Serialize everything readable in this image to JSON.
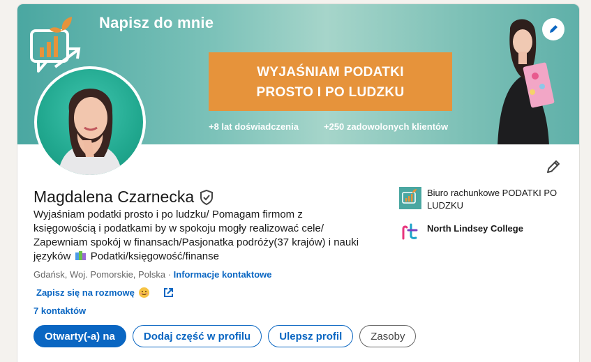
{
  "banner": {
    "heading": "Napisz do mnie",
    "box_line1": "WYJAŚNIAM PODATKI",
    "box_line2": "PROSTO I PO LUDZKU",
    "stat1": "+8 lat doświadczenia",
    "stat2": "+250 zadowolonych klientów"
  },
  "profile": {
    "name": "Magdalena Czarnecka",
    "headline_main": "Wyjaśniam podatki prosto i po ludzku/ Pomagam firmom z księgowością i podatkami by w spokoju mogły realizować cele/ Zapewniam spokój w finansach/Pasjonatka podróży(37 krajów) i nauki języków",
    "headline_tail": "Podatki/księgowość/finanse",
    "location": "Gdańsk, Woj. Pomorskie, Polska",
    "separator": "·",
    "contact_info": "Informacje kontaktowe",
    "booking_link": "Zapisz się na rozmowę",
    "connections": "7 kontaktów"
  },
  "buttons": {
    "open_to": "Otwarty(-a) na",
    "add_section": "Dodaj część w profilu",
    "enhance": "Ulepsz profil",
    "resources": "Zasoby"
  },
  "companies": [
    {
      "name": "Biuro rachunkowe PODATKI PO LUDZKU"
    },
    {
      "name": "North Lindsey College"
    }
  ],
  "icons": {
    "banner_edit": "pencil-icon",
    "intro_edit": "pencil-icon",
    "verified": "shield-check-icon",
    "external": "external-link-icon"
  },
  "colors": {
    "accent": "#0a66c2",
    "banner_box": "#e6933b",
    "banner_teal": "#7cc2b9"
  }
}
